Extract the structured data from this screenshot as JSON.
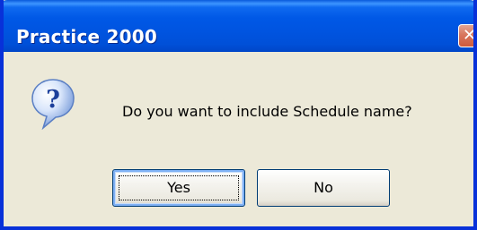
{
  "window": {
    "title": "Practice 2000"
  },
  "dialog": {
    "message": "Do you want to include Schedule name?",
    "icon": "question-icon"
  },
  "buttons": {
    "yes_label": "Yes",
    "no_label": "No"
  },
  "colors": {
    "titlebar": "#0054e3",
    "dialog_background": "#ece9d8",
    "close_button": "#d8765e",
    "button_border": "#003c74"
  }
}
